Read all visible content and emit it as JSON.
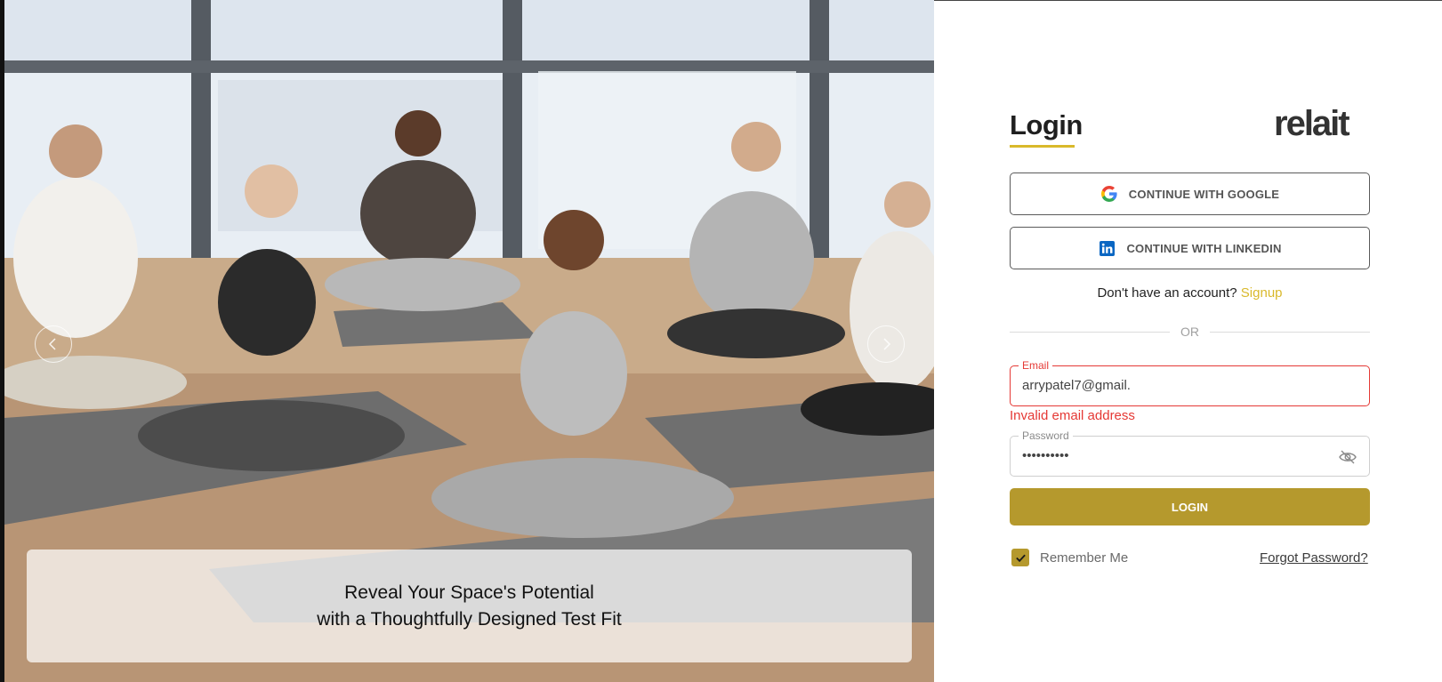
{
  "hero": {
    "caption_line1": "Reveal Your Space's Potential",
    "caption_line2": "with a Thoughtfully Designed Test Fit"
  },
  "panel": {
    "title": "Login",
    "logo_text": "relait",
    "google_label": "CONTINUE WITH GOOGLE",
    "linkedin_label": "CONTINUE WITH LINKEDIN",
    "signup_prompt": "Don't have an account?",
    "signup_link": "Signup",
    "or_text": "OR",
    "email_label": "Email",
    "email_value": "arrypatel7@gmail.",
    "email_error": "Invalid email address",
    "password_label": "Password",
    "password_value": "••••••••••",
    "login_label": "LOGIN",
    "remember_label": "Remember Me",
    "remember_checked": true,
    "forgot_label": "Forgot Password?"
  },
  "colors": {
    "accent": "#b5992d",
    "accent_light": "#d9b92b",
    "error": "#e53935"
  },
  "icons": [
    "chevron-left-icon",
    "chevron-right-icon",
    "google-icon",
    "linkedin-icon",
    "eye-off-icon",
    "check-icon"
  ]
}
